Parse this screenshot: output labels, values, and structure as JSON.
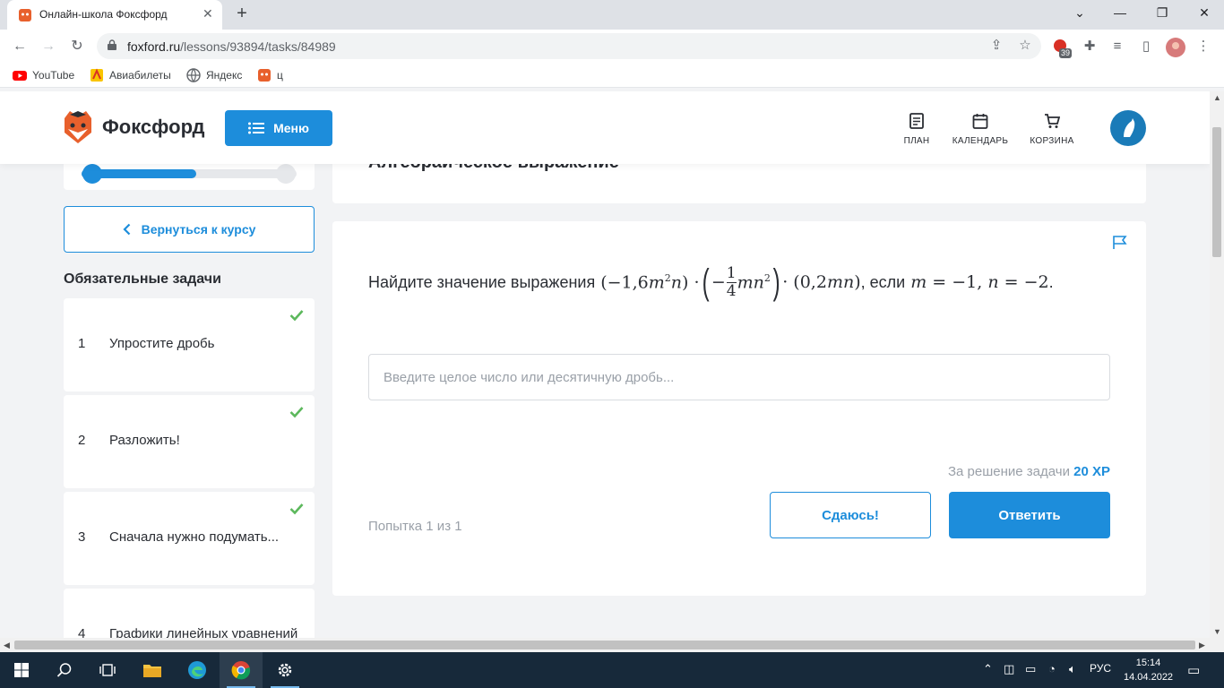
{
  "browser": {
    "tab_title": "Онлайн-школа Фоксфорд",
    "url_host": "foxford.ru",
    "url_path": "/lessons/93894/tasks/84989",
    "extension_badge": "39",
    "bookmarks": [
      {
        "label": "YouTube",
        "icon": "youtube-icon"
      },
      {
        "label": "Авиабилеты",
        "icon": "tickets-icon"
      },
      {
        "label": "Яндекс",
        "icon": "globe-icon"
      },
      {
        "label": "ц",
        "icon": "foxford-icon"
      }
    ]
  },
  "site": {
    "logo_text": "Фоксфорд",
    "menu_label": "Меню",
    "nav": [
      {
        "label": "ПЛАН",
        "icon": "plan-icon"
      },
      {
        "label": "КАЛЕНДАРЬ",
        "icon": "calendar-icon"
      },
      {
        "label": "КОРЗИНА",
        "icon": "cart-icon"
      }
    ],
    "accent_color": "#1d8ddb"
  },
  "sidebar": {
    "back_label": "Вернуться к курсу",
    "section_title": "Обязательные задачи",
    "tasks": [
      {
        "num": "1",
        "name": "Упростите дробь",
        "done": true
      },
      {
        "num": "2",
        "name": "Разложить!",
        "done": true
      },
      {
        "num": "3",
        "name": "Сначала нужно подумать...",
        "done": true
      },
      {
        "num": "4",
        "name": "Графики линейных уравнений",
        "done": false
      }
    ]
  },
  "main": {
    "lesson_title": "Алгебраическое выражение",
    "question_text": "Найдите значение выражения",
    "question_tail": ", если",
    "answer_placeholder": "Введите целое число или десятичную дробь...",
    "reward_prefix": "За решение задачи",
    "reward_xp": "20 XP",
    "attempt": "Попытка 1 из 1",
    "giveup_label": "Сдаюсь!",
    "submit_label": "Ответить"
  },
  "taskbar": {
    "lang": "РУС",
    "time": "15:14",
    "date": "14.04.2022"
  }
}
